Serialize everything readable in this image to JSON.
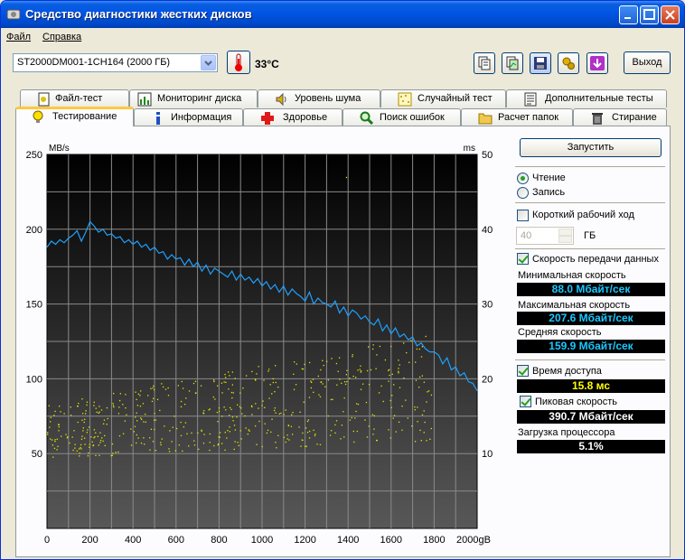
{
  "window": {
    "title": "Средство диагностики жестких дисков",
    "controls": {
      "minimize": "minimize-icon",
      "maximize": "maximize-icon",
      "close": "close-icon"
    }
  },
  "menu": {
    "file": "Файл",
    "help": "Справка"
  },
  "toolbar": {
    "drive": "ST2000DM001-1CH164 (2000 ГБ)",
    "temperature": "33°C",
    "exit_label": "Выход",
    "icons": [
      "copy-icon",
      "copy-green-icon",
      "save-icon",
      "options-icon",
      "down-arrow-icon"
    ]
  },
  "tabs_row1": [
    {
      "label": "Файл-тест",
      "icon": "file-test-icon"
    },
    {
      "label": "Мониторинг диска",
      "icon": "monitor-chart-icon"
    },
    {
      "label": "Уровень шума",
      "icon": "speaker-icon"
    },
    {
      "label": "Случайный тест",
      "icon": "random-dots-icon"
    },
    {
      "label": "Дополнительные тесты",
      "icon": "document-icon"
    }
  ],
  "tabs_row2": [
    {
      "label": "Тестирование",
      "icon": "bulb-icon",
      "active": true
    },
    {
      "label": "Информация",
      "icon": "info-icon"
    },
    {
      "label": "Здоровье",
      "icon": "health-cross-icon"
    },
    {
      "label": "Поиск ошибок",
      "icon": "magnifier-icon"
    },
    {
      "label": "Расчет папок",
      "icon": "folder-icon"
    },
    {
      "label": "Стирание",
      "icon": "trash-icon"
    }
  ],
  "controls": {
    "start_label": "Запустить",
    "read_label": "Чтение",
    "write_label": "Запись",
    "mode": "read",
    "short_stroke_label": "Короткий рабочий ход",
    "short_stroke_checked": false,
    "short_stroke_value": "40",
    "gb_label": "ГБ",
    "transfer_rate_label": "Скорость передачи данных",
    "transfer_rate_checked": true,
    "min_speed_label": "Минимальная скорость",
    "min_speed_value": "88.0 Мбайт/сек",
    "max_speed_label": "Максимальная скорость",
    "max_speed_value": "207.6 Мбайт/сек",
    "avg_speed_label": "Средняя скорость",
    "avg_speed_value": "159.9 Мбайт/сек",
    "access_time_label": "Время доступа",
    "access_time_checked": true,
    "access_time_value": "15.8 мс",
    "burst_rate_label": "Пиковая скорость",
    "burst_rate_checked": true,
    "burst_rate_value": "390.7 Мбайт/сек",
    "cpu_label": "Загрузка процессора",
    "cpu_value": "5.1%"
  },
  "chart_data": {
    "type": "line",
    "ylabel_left": "MB/s",
    "ylabel_right": "ms",
    "xlabel_unit": "gB",
    "x_ticks": [
      "0",
      "200",
      "400",
      "600",
      "800",
      "1000",
      "1200",
      "1400",
      "1600",
      "1800",
      "2000gB"
    ],
    "y_left_ticks": [
      "50",
      "100",
      "150",
      "200",
      "250"
    ],
    "y_right_ticks": [
      "10",
      "20",
      "30",
      "40",
      "50"
    ],
    "xlim": [
      0,
      2000
    ],
    "ylim_left": [
      0,
      250
    ],
    "ylim_right": [
      0,
      50
    ],
    "grid": true,
    "colors": {
      "transfer": "#1ea0ff",
      "access": "#e6e600",
      "background_top": "#000000",
      "background_bottom": "#585858"
    },
    "series": [
      {
        "axis": "left",
        "x": [
          0,
          20,
          40,
          60,
          80,
          100,
          120,
          140,
          160,
          180,
          200,
          220,
          240,
          260,
          280,
          300,
          320,
          340,
          360,
          380,
          400,
          420,
          440,
          460,
          480,
          500,
          520,
          540,
          560,
          580,
          600,
          620,
          640,
          660,
          680,
          700,
          720,
          740,
          760,
          780,
          800,
          820,
          840,
          860,
          880,
          900,
          920,
          940,
          960,
          980,
          1000,
          1020,
          1040,
          1060,
          1080,
          1100,
          1120,
          1140,
          1160,
          1180,
          1200,
          1220,
          1240,
          1260,
          1280,
          1300,
          1320,
          1340,
          1360,
          1380,
          1400,
          1420,
          1440,
          1460,
          1480,
          1500,
          1520,
          1540,
          1560,
          1580,
          1600,
          1620,
          1640,
          1660,
          1680,
          1700,
          1720,
          1740,
          1760,
          1780,
          1800,
          1820,
          1840,
          1860,
          1880,
          1900,
          1920,
          1940,
          1960,
          1980,
          2000
        ],
        "values": [
          188,
          192,
          190,
          193,
          191,
          194,
          196,
          199,
          192,
          198,
          205,
          202,
          198,
          200,
          196,
          197,
          194,
          195,
          191,
          193,
          190,
          192,
          188,
          190,
          186,
          188,
          184,
          185,
          180,
          183,
          180,
          181,
          176,
          180,
          175,
          178,
          172,
          176,
          170,
          174,
          172,
          170,
          168,
          172,
          166,
          170,
          166,
          168,
          164,
          167,
          162,
          165,
          160,
          163,
          158,
          162,
          156,
          160,
          157,
          155,
          152,
          158,
          150,
          154,
          151,
          150,
          148,
          152,
          144,
          148,
          142,
          146,
          144,
          140,
          142,
          138,
          136,
          140,
          132,
          136,
          130,
          134,
          128,
          130,
          126,
          128,
          122,
          124,
          120,
          118,
          118,
          116,
          110,
          114,
          106,
          108,
          102,
          104,
          98,
          97,
          92
        ]
      }
    ],
    "access_time_points": "scattered 15-25 ms across 0-1800 gB, one outlier near 47 ms at ~1390 gB"
  }
}
